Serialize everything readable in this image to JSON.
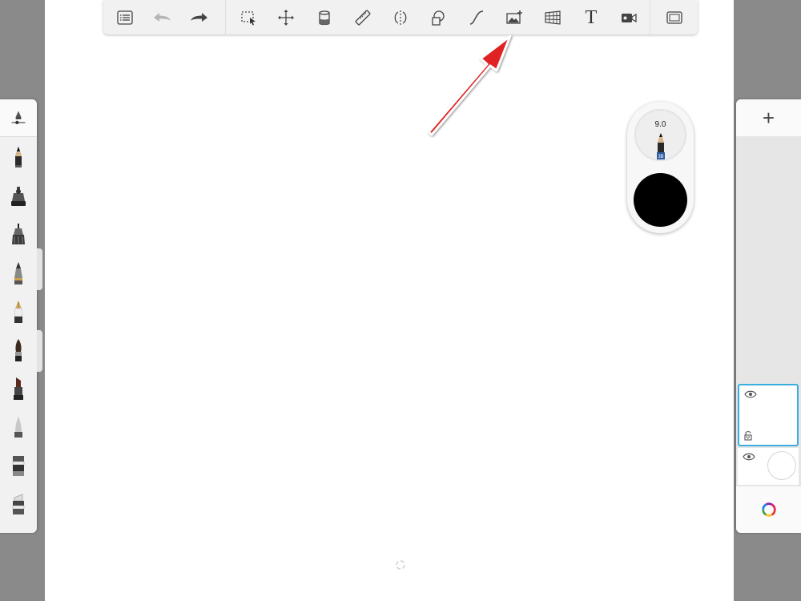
{
  "toolbar": {
    "tools": [
      {
        "name": "list-icon"
      },
      {
        "name": "undo-icon"
      },
      {
        "name": "redo-icon"
      },
      {
        "name": "selection-icon"
      },
      {
        "name": "transform-icon"
      },
      {
        "name": "fill-icon"
      },
      {
        "name": "ruler-icon"
      },
      {
        "name": "symmetry-icon"
      },
      {
        "name": "shape-icon"
      },
      {
        "name": "curve-icon"
      },
      {
        "name": "import-image-icon"
      },
      {
        "name": "perspective-icon"
      },
      {
        "name": "text-icon",
        "label": "T"
      },
      {
        "name": "video-icon"
      },
      {
        "name": "fullscreen-icon"
      }
    ]
  },
  "brush_puck": {
    "size_value": "9.0",
    "pencil_grade": "3B",
    "color": "#000000"
  },
  "left_panel": {
    "brushes": [
      "brush-settings",
      "pencil",
      "airbrush",
      "technical-pen",
      "ballpoint-pen",
      "fountain-pen",
      "paintbrush",
      "chisel-marker",
      "soft-eraser",
      "smudge",
      "hard-eraser"
    ]
  },
  "right_panel": {
    "add_label": "+",
    "layers": [
      {
        "name": "layer-1",
        "selected": true
      },
      {
        "name": "background-layer",
        "selected": false
      }
    ]
  },
  "colors": {
    "accent": "#3aaee0",
    "arrow": "#e02020",
    "background": "#8a8a8a",
    "panel": "#f1f1f1"
  }
}
